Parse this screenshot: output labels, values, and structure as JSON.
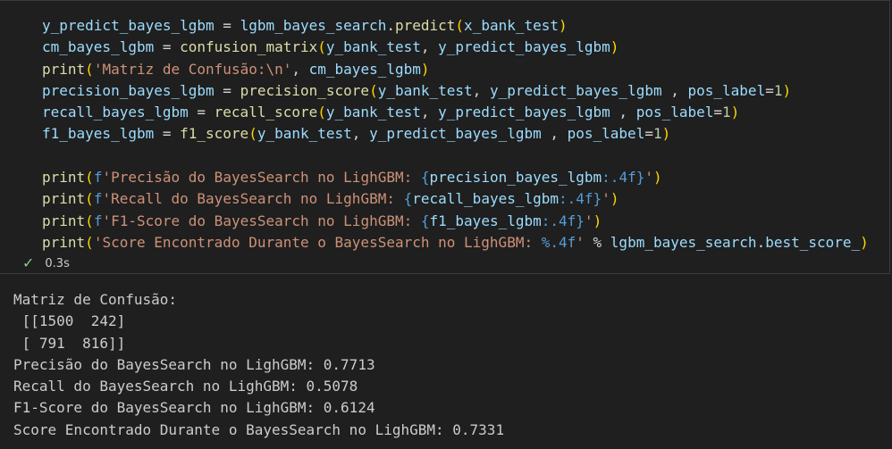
{
  "cell": {
    "status": {
      "icon": "check-icon",
      "time": "0.3s"
    },
    "code_tokens": [
      [
        [
          "v",
          "y_predict_bayes_lgbm "
        ],
        [
          "op",
          "= "
        ],
        [
          "v",
          "lgbm_bayes_search"
        ],
        [
          "op",
          "."
        ],
        [
          "f",
          "predict"
        ],
        [
          "p1",
          "("
        ],
        [
          "v",
          "x_bank_test"
        ],
        [
          "p1",
          ")"
        ]
      ],
      [
        [
          "v",
          "cm_bayes_lgbm "
        ],
        [
          "op",
          "= "
        ],
        [
          "f",
          "confusion_matrix"
        ],
        [
          "p1",
          "("
        ],
        [
          "v",
          "y_bank_test"
        ],
        [
          "op",
          ", "
        ],
        [
          "v",
          "y_predict_bayes_lgbm"
        ],
        [
          "p1",
          ")"
        ]
      ],
      [
        [
          "f",
          "print"
        ],
        [
          "p1",
          "("
        ],
        [
          "s",
          "'Matriz de Confusão:\\n'"
        ],
        [
          "op",
          ", "
        ],
        [
          "v",
          "cm_bayes_lgbm"
        ],
        [
          "p1",
          ")"
        ]
      ],
      [
        [
          "v",
          "precision_bayes_lgbm "
        ],
        [
          "op",
          "= "
        ],
        [
          "f",
          "precision_score"
        ],
        [
          "p1",
          "("
        ],
        [
          "v",
          "y_bank_test"
        ],
        [
          "op",
          ", "
        ],
        [
          "v",
          "y_predict_bayes_lgbm "
        ],
        [
          "op",
          ", "
        ],
        [
          "v",
          "pos_label"
        ],
        [
          "op",
          "="
        ],
        [
          "n",
          "1"
        ],
        [
          "p1",
          ")"
        ]
      ],
      [
        [
          "v",
          "recall_bayes_lgbm "
        ],
        [
          "op",
          "= "
        ],
        [
          "f",
          "recall_score"
        ],
        [
          "p1",
          "("
        ],
        [
          "v",
          "y_bank_test"
        ],
        [
          "op",
          ", "
        ],
        [
          "v",
          "y_predict_bayes_lgbm "
        ],
        [
          "op",
          ", "
        ],
        [
          "v",
          "pos_label"
        ],
        [
          "op",
          "="
        ],
        [
          "n",
          "1"
        ],
        [
          "p1",
          ")"
        ]
      ],
      [
        [
          "v",
          "f1_bayes_lgbm "
        ],
        [
          "op",
          "= "
        ],
        [
          "f",
          "f1_score"
        ],
        [
          "p1",
          "("
        ],
        [
          "v",
          "y_bank_test"
        ],
        [
          "op",
          ", "
        ],
        [
          "v",
          "y_predict_bayes_lgbm "
        ],
        [
          "op",
          ", "
        ],
        [
          "v",
          "pos_label"
        ],
        [
          "op",
          "="
        ],
        [
          "n",
          "1"
        ],
        [
          "p1",
          ")"
        ]
      ],
      [],
      [
        [
          "f",
          "print"
        ],
        [
          "p1",
          "("
        ],
        [
          "kw",
          "f"
        ],
        [
          "s",
          "'Precisão do BayesSearch no LighGBM: "
        ],
        [
          "kw",
          "{"
        ],
        [
          "v",
          "precision_bayes_lgbm"
        ],
        [
          "kw",
          ":.4f}"
        ],
        [
          "s",
          "'"
        ],
        [
          "p1",
          ")"
        ]
      ],
      [
        [
          "f",
          "print"
        ],
        [
          "p1",
          "("
        ],
        [
          "kw",
          "f"
        ],
        [
          "s",
          "'Recall do BayesSearch no LighGBM: "
        ],
        [
          "kw",
          "{"
        ],
        [
          "v",
          "recall_bayes_lgbm"
        ],
        [
          "kw",
          ":.4f}"
        ],
        [
          "s",
          "'"
        ],
        [
          "p1",
          ")"
        ]
      ],
      [
        [
          "f",
          "print"
        ],
        [
          "p1",
          "("
        ],
        [
          "kw",
          "f"
        ],
        [
          "s",
          "'F1-Score do BayesSearch no LighGBM: "
        ],
        [
          "kw",
          "{"
        ],
        [
          "v",
          "f1_bayes_lgbm"
        ],
        [
          "kw",
          ":.4f}"
        ],
        [
          "s",
          "'"
        ],
        [
          "p1",
          ")"
        ]
      ],
      [
        [
          "f",
          "print"
        ],
        [
          "p1",
          "("
        ],
        [
          "s",
          "'Score Encontrado Durante o BayesSearch no LighGBM: "
        ],
        [
          "kw",
          "%.4f"
        ],
        [
          "s",
          "'"
        ],
        [
          "op",
          " % "
        ],
        [
          "v",
          "lgbm_bayes_search"
        ],
        [
          "op",
          "."
        ],
        [
          "v",
          "best_score_"
        ],
        [
          "p1",
          ")"
        ]
      ]
    ]
  },
  "output": {
    "lines": [
      "Matriz de Confusão:",
      " [[1500  242]",
      " [ 791  816]]",
      "Precisão do BayesSearch no LighGBM: 0.7713",
      "Recall do BayesSearch no LighGBM: 0.5078",
      "F1-Score do BayesSearch no LighGBM: 0.6124",
      "Score Encontrado Durante o BayesSearch no LighGBM: 0.7331"
    ]
  }
}
